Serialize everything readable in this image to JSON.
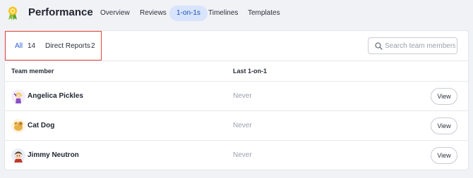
{
  "header": {
    "title": "Performance",
    "tabs": [
      {
        "label": "Overview",
        "active": false
      },
      {
        "label": "Reviews",
        "active": false
      },
      {
        "label": "1-on-1s",
        "active": true
      },
      {
        "label": "Timelines",
        "active": false
      },
      {
        "label": "Templates",
        "active": false
      }
    ]
  },
  "filters": {
    "all_label": "All",
    "all_count": "14",
    "direct_label": "Direct Reports",
    "direct_count": "2"
  },
  "search": {
    "placeholder": "Search team members...",
    "value": ""
  },
  "table": {
    "columns": [
      "Team member",
      "Last 1-on-1"
    ],
    "rows": [
      {
        "name": "Angelica Pickles",
        "last": "Never",
        "action": "View"
      },
      {
        "name": "Cat Dog",
        "last": "Never",
        "action": "View"
      },
      {
        "name": "Jimmy Neutron",
        "last": "Never",
        "action": "View"
      }
    ]
  },
  "colors": {
    "accent": "#2a5fd6",
    "active_tab_bg": "#d8e4fb",
    "highlight_border": "#e0483c",
    "muted_text": "#9aa0ab",
    "background": "#f1f2f6"
  },
  "icons": {
    "logo": "ribbon-award-icon",
    "search": "search-icon"
  }
}
